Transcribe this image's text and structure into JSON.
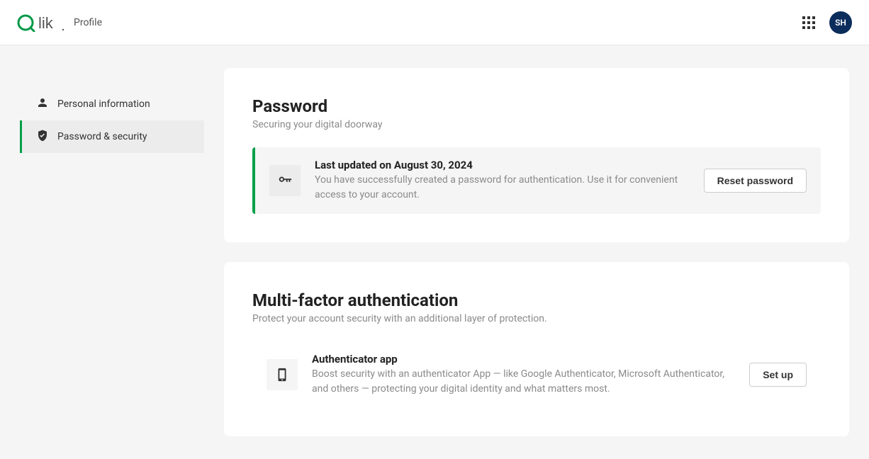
{
  "header": {
    "page_label": "Profile",
    "avatar_initials": "SH"
  },
  "sidebar": {
    "items": [
      {
        "label": "Personal information",
        "active": false
      },
      {
        "label": "Password & security",
        "active": true
      }
    ]
  },
  "password_section": {
    "title": "Password",
    "subtitle": "Securing your digital doorway",
    "info_title": "Last updated on August 30, 2024",
    "info_desc": "You have successfully created a password for authentication. Use it for convenient access to your account.",
    "button_label": "Reset password"
  },
  "mfa_section": {
    "title": "Multi-factor authentication",
    "subtitle": "Protect your account security with an additional layer of protection.",
    "info_title": "Authenticator app",
    "info_desc": "Boost security with an authenticator App — like Google Authenticator, Microsoft Authenticator, and others — protecting your digital identity and what matters most.",
    "button_label": "Set up"
  }
}
